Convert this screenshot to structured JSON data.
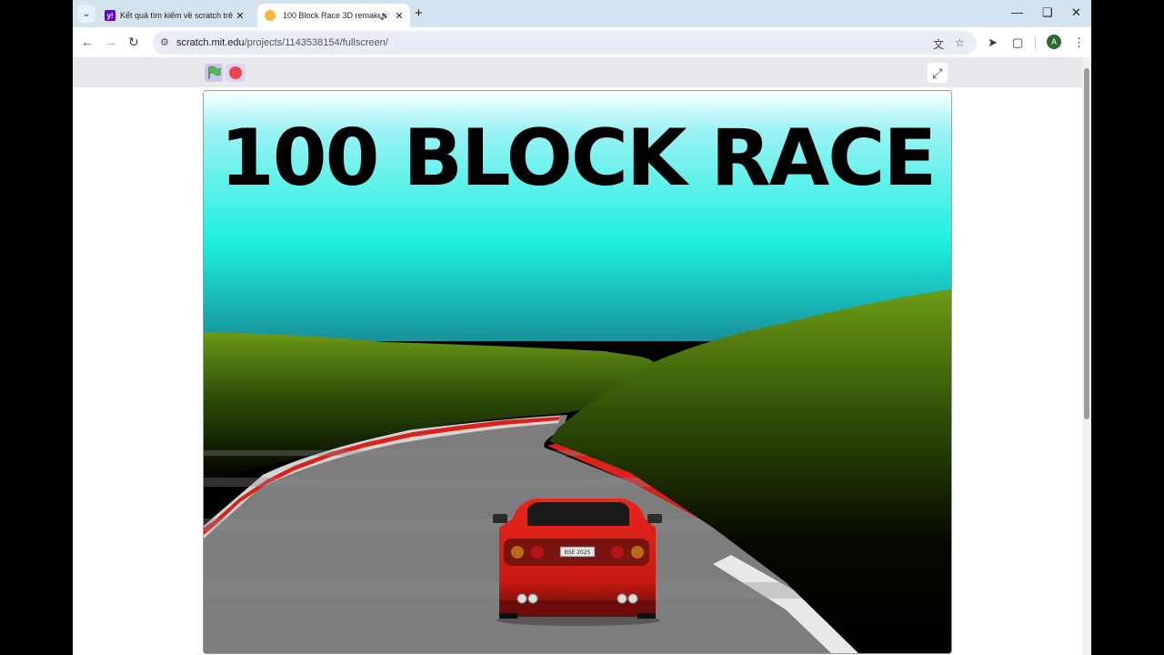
{
  "tabs": [
    {
      "title": "Kết quả tìm kiếm về scratch trê",
      "favicon": "yahoo-icon"
    },
    {
      "title": "100 Block Race 3D remake",
      "favicon": "scratch-icon",
      "audio": true
    }
  ],
  "address_bar": {
    "host": "scratch.mit.edu",
    "path": "/projects/1143538154/fullscreen/"
  },
  "profile_initial": "A",
  "game": {
    "title": "100 BLOCK RACE",
    "plate": "BSE 2025"
  },
  "colors": {
    "accent": "#d3e3f0",
    "car": "#d8221b",
    "stop": "#e9474c"
  }
}
